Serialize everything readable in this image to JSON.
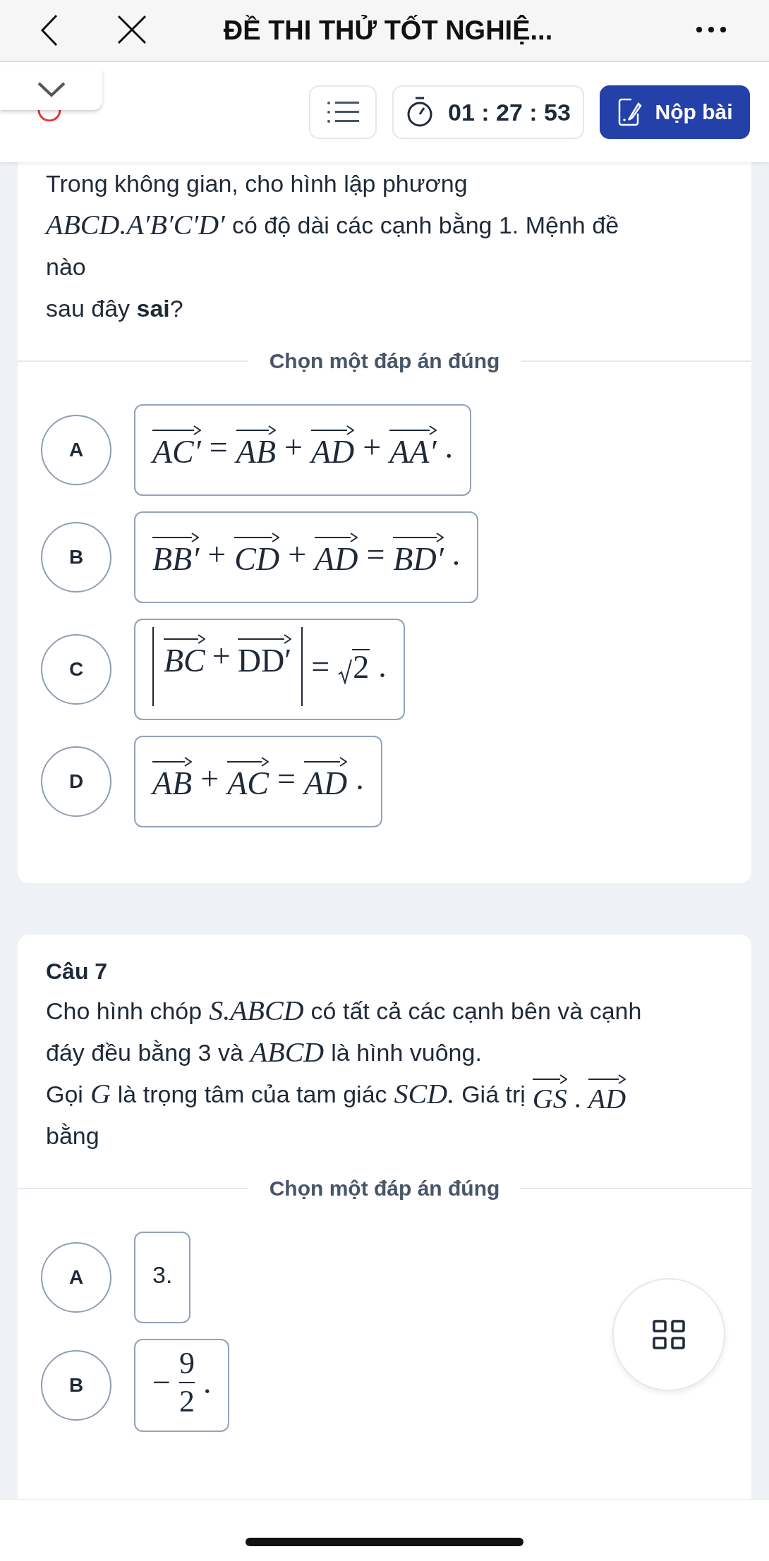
{
  "header": {
    "title": "ĐỀ THI THỬ TỐT NGHIỆ..."
  },
  "toolbar": {
    "timer": "01 : 27 : 53",
    "submit_label": "Nộp bài"
  },
  "questions": [
    {
      "lines": [
        [
          {
            "kind": "text",
            "text": "Trong không gian, cho hình lập phương"
          }
        ],
        [
          {
            "kind": "math",
            "text": "ABCD.A′B′C′D′"
          },
          {
            "kind": "text",
            "text": "có độ dài các cạnh bằng 1. Mệnh đề"
          }
        ],
        [
          {
            "kind": "text",
            "text": "nào"
          }
        ],
        [
          {
            "kind": "text",
            "text": "sau đây **sai**?"
          }
        ]
      ],
      "prompt": "Chọn một đáp án đúng",
      "options": [
        {
          "letter": "A",
          "content": [
            {
              "kind": "vec",
              "text": "AC′"
            },
            {
              "kind": "op",
              "text": "="
            },
            {
              "kind": "vec",
              "text": "AB"
            },
            {
              "kind": "op",
              "text": "+"
            },
            {
              "kind": "vec",
              "text": "AD"
            },
            {
              "kind": "op",
              "text": "+"
            },
            {
              "kind": "vec",
              "text": "AA′"
            },
            {
              "kind": "op",
              "text": "."
            }
          ]
        },
        {
          "letter": "B",
          "content": [
            {
              "kind": "vec",
              "text": "BB′"
            },
            {
              "kind": "op",
              "text": "+"
            },
            {
              "kind": "vec",
              "text": "CD"
            },
            {
              "kind": "op",
              "text": "+"
            },
            {
              "kind": "vec",
              "text": "AD"
            },
            {
              "kind": "op",
              "text": "="
            },
            {
              "kind": "vec",
              "text": "BD′"
            },
            {
              "kind": "op",
              "text": "."
            }
          ]
        },
        {
          "letter": "C",
          "content": [
            {
              "kind": "abs",
              "terms": [
                {
                  "kind": "vec",
                  "text": "BC"
                },
                {
                  "kind": "op",
                  "text": "+"
                },
                {
                  "kind": "vec",
                  "text": "DD′",
                  "upright": true
                }
              ]
            },
            {
              "kind": "op",
              "text": "="
            },
            {
              "kind": "sqrt",
              "text": "2"
            },
            {
              "kind": "op",
              "text": "."
            }
          ]
        },
        {
          "letter": "D",
          "content": [
            {
              "kind": "vec",
              "text": "AB"
            },
            {
              "kind": "op",
              "text": "+"
            },
            {
              "kind": "vec",
              "text": "AC"
            },
            {
              "kind": "op",
              "text": "="
            },
            {
              "kind": "vec",
              "text": "AD"
            },
            {
              "kind": "op",
              "text": "."
            }
          ]
        }
      ]
    },
    {
      "title": "Câu 7",
      "lines": [
        [
          {
            "kind": "text",
            "text": "Cho hình chóp"
          },
          {
            "kind": "math",
            "text": "S.ABCD"
          },
          {
            "kind": "text",
            "text": "có tất cả các cạnh bên và cạnh"
          }
        ],
        [
          {
            "kind": "text",
            "text": "đáy đều bằng 3 và"
          },
          {
            "kind": "math",
            "text": "ABCD"
          },
          {
            "kind": "text",
            "text": "là hình vuông."
          }
        ],
        [
          {
            "kind": "text",
            "text": "Gọi"
          },
          {
            "kind": "math",
            "text": "G"
          },
          {
            "kind": "text",
            "text": "là trọng tâm của tam giác"
          },
          {
            "kind": "math",
            "text": "SCD."
          },
          {
            "kind": "text",
            "text": "Giá trị"
          },
          {
            "kind": "vec",
            "text": "GS"
          },
          {
            "kind": "op",
            "text": "."
          },
          {
            "kind": "vec",
            "text": "AD"
          }
        ],
        [
          {
            "kind": "text",
            "text": "bằng"
          }
        ]
      ],
      "prompt": "Chọn một đáp án đúng",
      "options": [
        {
          "letter": "A",
          "content": [
            {
              "kind": "text",
              "text": "3."
            }
          ]
        },
        {
          "letter": "B",
          "content": [
            {
              "kind": "op",
              "text": "−"
            },
            {
              "kind": "frac",
              "num": "9",
              "den": "2"
            },
            {
              "kind": "op",
              "text": "."
            }
          ]
        }
      ]
    }
  ]
}
